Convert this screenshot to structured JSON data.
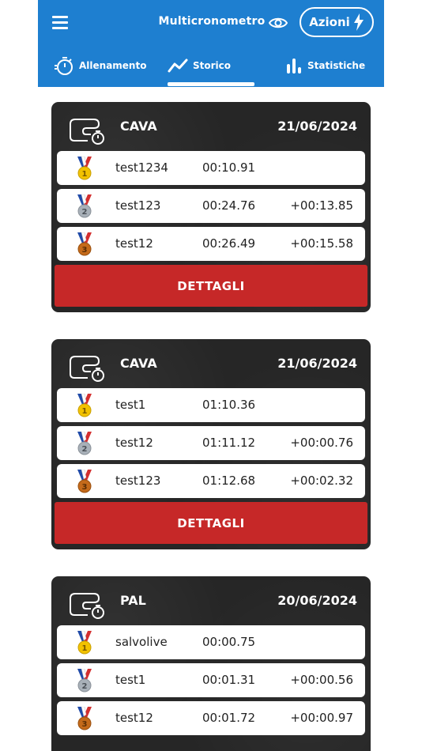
{
  "header": {
    "title": "Multicronometro",
    "actions_label": "Azioni"
  },
  "tabs": [
    {
      "label": "Allenamento",
      "icon": "stopwatch-icon"
    },
    {
      "label": "Storico",
      "icon": "trend-line-icon",
      "active": true
    },
    {
      "label": "Statistiche",
      "icon": "bar-chart-icon"
    }
  ],
  "colors": {
    "appbar": "#1e7fd0",
    "card_bg": "#262626",
    "details_button": "#c62828",
    "gold": "#f2c200",
    "silver": "#a8b0b8",
    "bronze": "#c46a1a"
  },
  "sessions": [
    {
      "track": "CAVA",
      "date": "21/06/2024",
      "details_label": "DETTAGLI",
      "results": [
        {
          "rank": "1",
          "name": "test1234",
          "time": "00:10.91",
          "gap": ""
        },
        {
          "rank": "2",
          "name": "test123",
          "time": "00:24.76",
          "gap": "+00:13.85"
        },
        {
          "rank": "3",
          "name": "test12",
          "time": "00:26.49",
          "gap": "+00:15.58"
        }
      ]
    },
    {
      "track": "CAVA",
      "date": "21/06/2024",
      "details_label": "DETTAGLI",
      "results": [
        {
          "rank": "1",
          "name": "test1",
          "time": "01:10.36",
          "gap": ""
        },
        {
          "rank": "2",
          "name": "test12",
          "time": "01:11.12",
          "gap": "+00:00.76"
        },
        {
          "rank": "3",
          "name": "test123",
          "time": "01:12.68",
          "gap": "+00:02.32"
        }
      ]
    },
    {
      "track": "PAL",
      "date": "20/06/2024",
      "results": [
        {
          "rank": "1",
          "name": "salvolive",
          "time": "00:00.75",
          "gap": ""
        },
        {
          "rank": "2",
          "name": "test1",
          "time": "00:01.31",
          "gap": "+00:00.56"
        },
        {
          "rank": "3",
          "name": "test12",
          "time": "00:01.72",
          "gap": "+00:00.97"
        }
      ]
    }
  ]
}
